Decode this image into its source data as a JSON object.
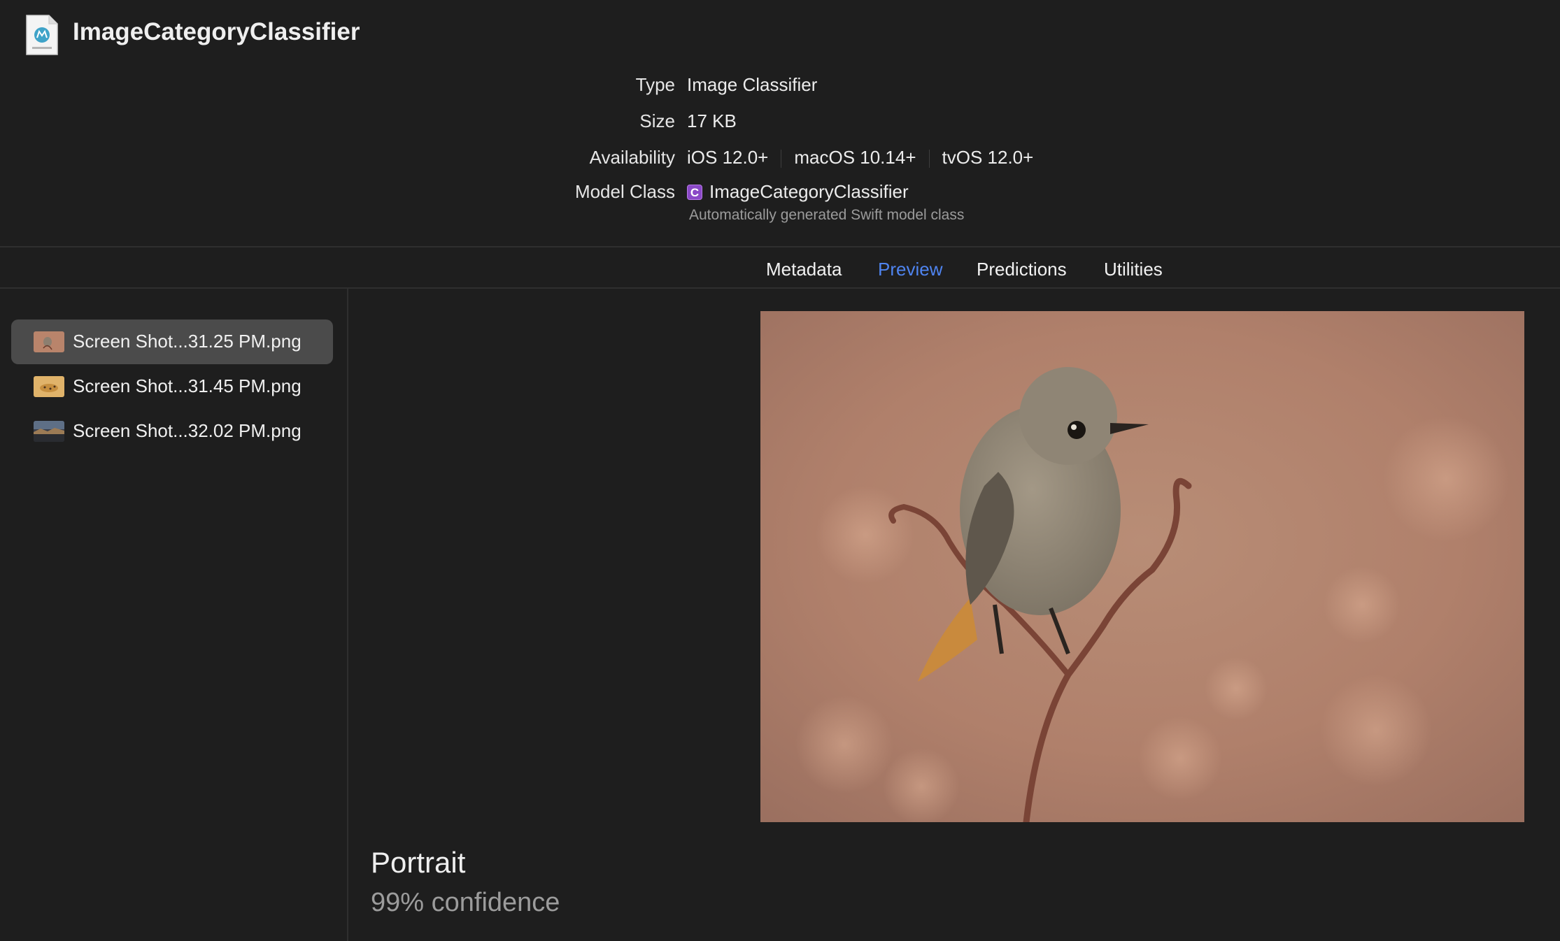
{
  "model": {
    "title": "ImageCategoryClassifier",
    "icon": "mlmodel-file-icon"
  },
  "info": {
    "type_label": "Type",
    "type_value": "Image Classifier",
    "size_label": "Size",
    "size_value": "17 KB",
    "availability_label": "Availability",
    "availability": [
      "iOS 12.0+",
      "macOS 10.14+",
      "tvOS 12.0+"
    ],
    "model_class_label": "Model Class",
    "model_class_badge": "C",
    "model_class_value": "ImageCategoryClassifier",
    "model_class_note": "Automatically generated Swift model class"
  },
  "tabs": [
    {
      "label": "Metadata",
      "active": false
    },
    {
      "label": "Preview",
      "active": true
    },
    {
      "label": "Predictions",
      "active": false
    },
    {
      "label": "Utilities",
      "active": false
    }
  ],
  "files": [
    {
      "name": "Screen Shot...31.25 PM.png",
      "selected": true,
      "thumb": "bird-thumbnail"
    },
    {
      "name": "Screen Shot...31.45 PM.png",
      "selected": false,
      "thumb": "cheetah-thumbnail"
    },
    {
      "name": "Screen Shot...32.02 PM.png",
      "selected": false,
      "thumb": "landscape-thumbnail"
    }
  ],
  "result": {
    "label": "Portrait",
    "confidence": "99% confidence"
  },
  "colors": {
    "background": "#1e1e1e",
    "accent": "#4f84f0",
    "selected_row": "#4b4b4b",
    "class_badge": "#8a48c7"
  }
}
